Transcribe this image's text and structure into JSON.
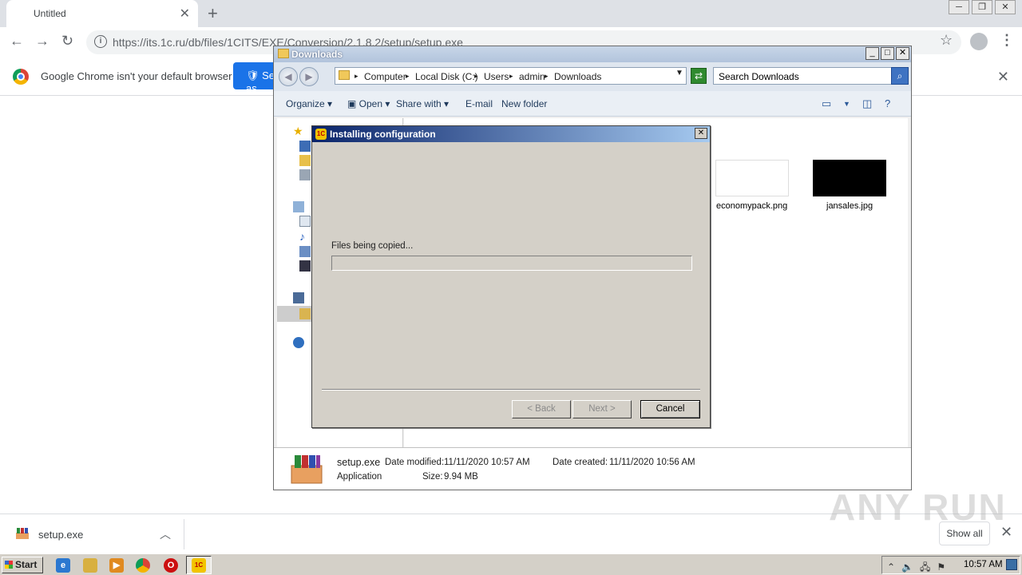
{
  "browser": {
    "tab_title": "Untitled",
    "url": "https://its.1c.ru/db/files/1CITS/EXE/Conversion/2.1.8.2/setup/setup.exe",
    "infobar_text": "Google Chrome isn't your default browser",
    "infobar_button": "Set as default"
  },
  "explorer": {
    "title": "Downloads",
    "breadcrumbs": [
      "Computer",
      "Local Disk (C:)",
      "Users",
      "admin",
      "Downloads"
    ],
    "search_placeholder": "Search Downloads",
    "commands": {
      "organize": "Organize",
      "open": "Open",
      "share_with": "Share with",
      "email": "E-mail",
      "new_folder": "New folder"
    },
    "files": [
      {
        "name": "economypack.png"
      },
      {
        "name": "jansales.jpg"
      }
    ],
    "details": {
      "name": "setup.exe",
      "type": "Application",
      "modified_label": "Date modified:",
      "modified": "11/11/2020 10:57 AM",
      "created_label": "Date created:",
      "created": "11/11/2020 10:56 AM",
      "size_label": "Size:",
      "size": "9.94 MB"
    }
  },
  "dialog": {
    "title": "Installing configuration",
    "status": "Files being copied...",
    "progress": 0,
    "back": "< Back",
    "next": "Next >",
    "cancel": "Cancel"
  },
  "downloads_shelf": {
    "file": "setup.exe",
    "show_all": "Show all"
  },
  "watermark": "ANY RUN",
  "taskbar": {
    "start": "Start",
    "clock": "10:57 AM"
  },
  "colors": {
    "dialog_title_start": "#0a246a",
    "dialog_title_end": "#a6caf0",
    "chrome_blue": "#1a73e8",
    "classic_gray": "#d4d0c8"
  }
}
